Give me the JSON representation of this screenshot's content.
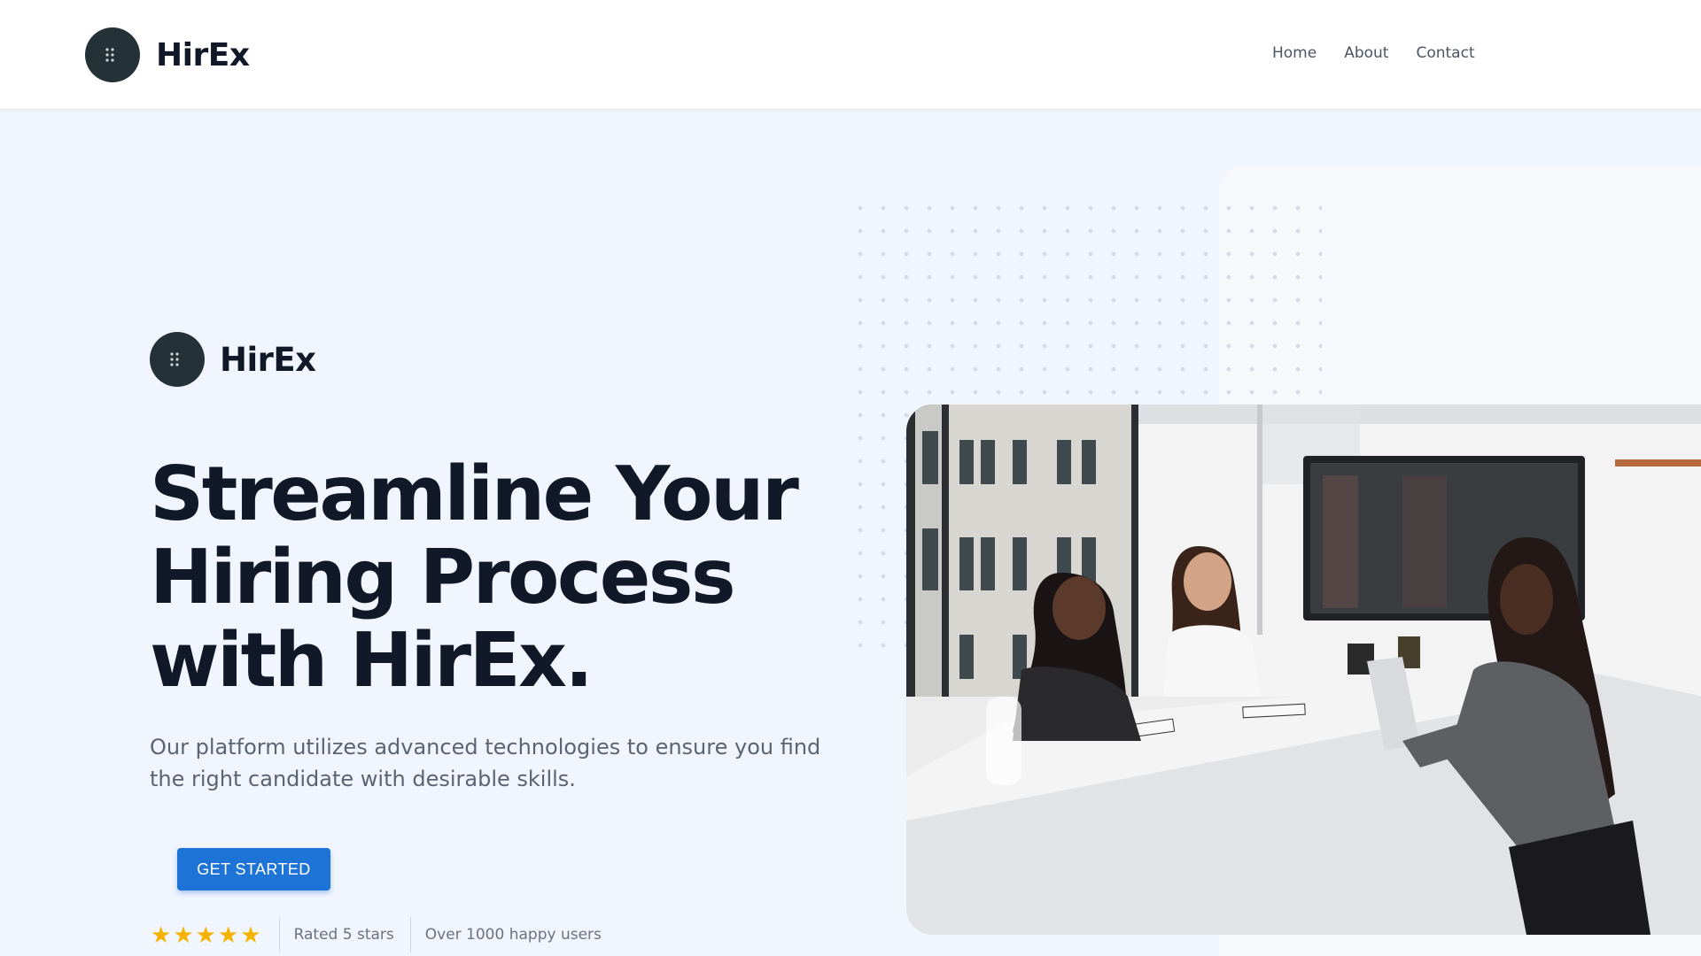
{
  "header": {
    "brand_name": "HirEx",
    "logo_icon": "grid-dots-icon",
    "nav": [
      {
        "label": "Home"
      },
      {
        "label": "About"
      },
      {
        "label": "Contact"
      }
    ]
  },
  "hero": {
    "brand_name": "HirEx",
    "headline_lines": [
      "Streamline Your",
      "Hiring Process",
      "with HirEx."
    ],
    "subtext": "Our platform utilizes advanced technologies to ensure you find the right candidate with desirable skills.",
    "cta_label": "GET STARTED",
    "rating": {
      "stars": 5,
      "rated_text": "Rated 5 stars",
      "users_text": "Over 1000 happy users"
    }
  },
  "colors": {
    "page_bg": "#f1f5fd",
    "logo_bg": "#243238",
    "cta_bg": "#1e74d6",
    "star": "#f5b301",
    "heading": "#111827"
  },
  "image": {
    "subject": "three women in a meeting around a white table in an office"
  }
}
